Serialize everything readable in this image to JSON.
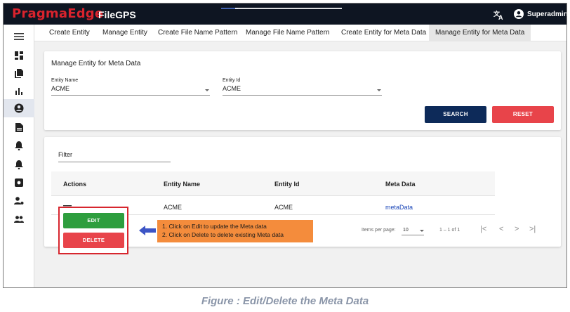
{
  "app": {
    "logo_text": "PragmaEdge",
    "product": "FileGPS",
    "user": "Superadmin"
  },
  "tabs": [
    {
      "label": "Create Entity"
    },
    {
      "label": "Manage Entity"
    },
    {
      "label": "Create File Name Pattern"
    },
    {
      "label": "Manage File Name Pattern"
    },
    {
      "label": "Create Entity for Meta Data"
    },
    {
      "label": "Manage Entity for Meta Data"
    }
  ],
  "form": {
    "title": "Manage Entity for Meta Data",
    "entity_name_label": "Entity Name",
    "entity_name_value": "ACME",
    "entity_id_label": "Entity Id",
    "entity_id_value": "ACME",
    "search_label": "SEARCH",
    "reset_label": "RESET"
  },
  "table": {
    "filter_label": "Filter",
    "columns": [
      "Actions",
      "Entity Name",
      "Entity Id",
      "Meta Data"
    ],
    "rows": [
      {
        "entity_name": "ACME",
        "entity_id": "ACME",
        "meta_data": "metaData"
      }
    ],
    "items_per_page_label": "Items per page:",
    "items_per_page_value": "10",
    "range_label": "1 – 1 of 1"
  },
  "actions": {
    "edit_label": "EDIT",
    "delete_label": "DELETE"
  },
  "callout": {
    "line1": "1. Click on Edit to update the Meta data",
    "line2": "2. Click on Delete to delete existing Meta data"
  },
  "caption": "Figure : Edit/Delete the Meta Data",
  "colors": {
    "topbar": "#0e1522",
    "brand_red": "#d9232d",
    "search_button": "#0d2a59",
    "reset_button": "#e8444a",
    "edit_button": "#2e9e3e",
    "delete_button": "#e8444a",
    "callout": "#f48c3c",
    "arrow": "#3d55c6"
  }
}
